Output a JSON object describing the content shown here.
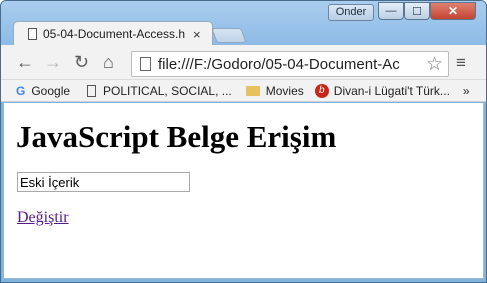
{
  "window": {
    "user_label": "Onder",
    "controls": {
      "minimize": "—",
      "maximize": "☐",
      "close": "✕"
    }
  },
  "tab": {
    "title": "05-04-Document-Access.h",
    "close": "×"
  },
  "toolbar": {
    "back": "←",
    "forward": "→",
    "reload": "↻",
    "home": "⌂",
    "url": "file:///F:/Godoro/05-04-Document-Ac",
    "star": "☆",
    "menu": "≡"
  },
  "bookmarks": {
    "items": [
      {
        "label": "Google",
        "icon": "google-icon"
      },
      {
        "label": "POLITICAL, SOCIAL, ...",
        "icon": "page-icon"
      },
      {
        "label": "Movies",
        "icon": "folder-icon"
      },
      {
        "label": "Divan-i Lügati't Türk...",
        "icon": "red-circle-icon"
      }
    ],
    "overflow": "»"
  },
  "page": {
    "heading": "JavaScript Belge Erişim",
    "input_value": "Eski İçerik",
    "link_text": "Değiştir"
  }
}
